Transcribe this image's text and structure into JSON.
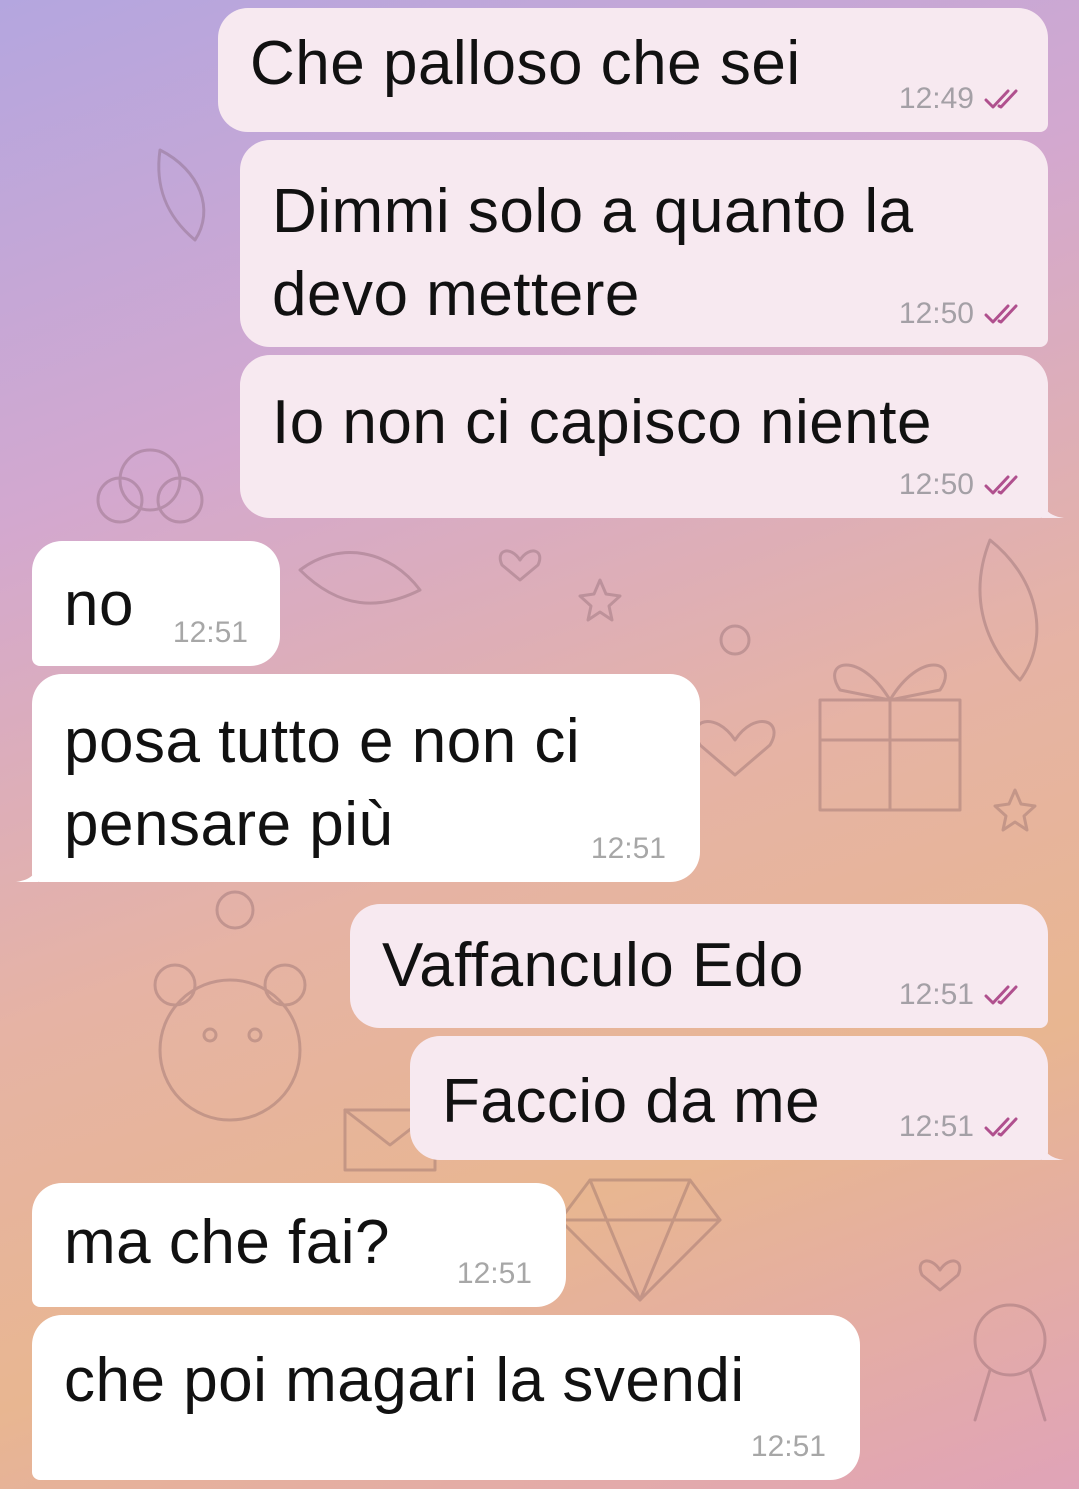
{
  "theme": {
    "outgoing_bubble": "#f7e9f0",
    "incoming_bubble": "#ffffff",
    "read_check_color": "#b0508e"
  },
  "messages": [
    {
      "direction": "out",
      "text": "Che palloso che sei",
      "time": "12:49",
      "status": "read"
    },
    {
      "direction": "out",
      "text": "Dimmi solo a quanto la\ndevo mettere",
      "time": "12:50",
      "status": "read"
    },
    {
      "direction": "out",
      "text": "Io non ci capisco niente",
      "time": "12:50",
      "status": "read"
    },
    {
      "direction": "in",
      "text": "no",
      "time": "12:51"
    },
    {
      "direction": "in",
      "text": "posa tutto e non ci\npensare più",
      "time": "12:51"
    },
    {
      "direction": "out",
      "text": "Vaffanculo Edo",
      "time": "12:51",
      "status": "read"
    },
    {
      "direction": "out",
      "text": "Faccio da me",
      "time": "12:51",
      "status": "read"
    },
    {
      "direction": "in",
      "text": "ma che fai?",
      "time": "12:51"
    },
    {
      "direction": "in",
      "text": "che poi magari la svendi",
      "time": "12:51"
    }
  ]
}
